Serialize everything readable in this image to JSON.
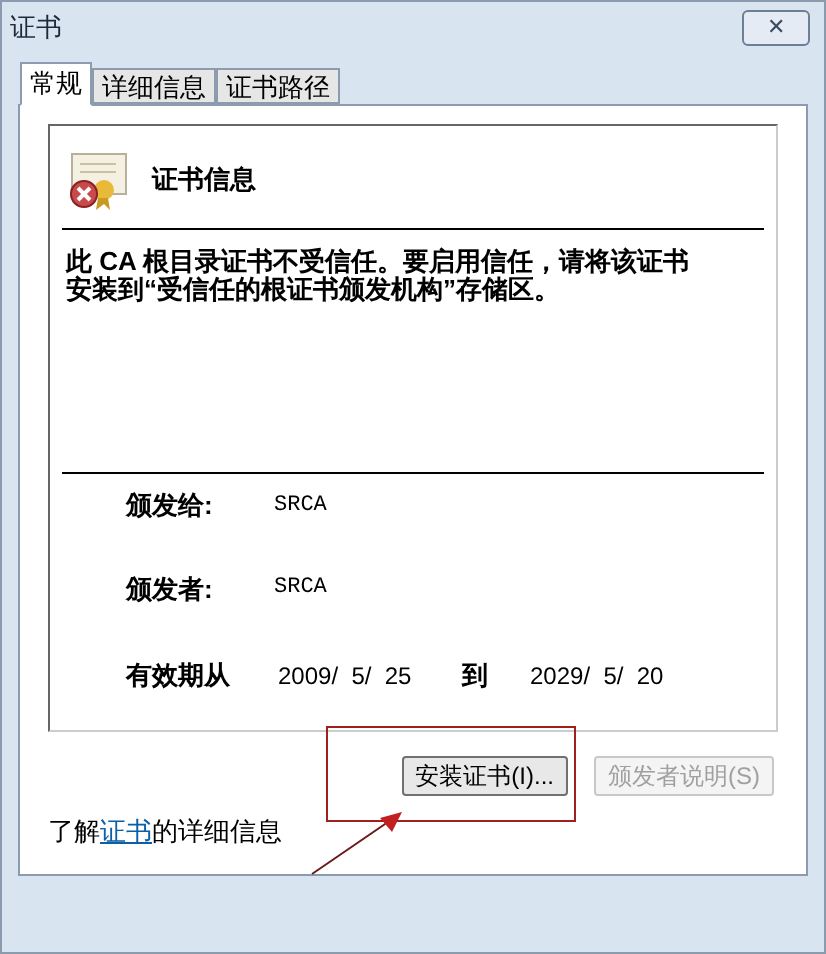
{
  "window": {
    "title": "证书",
    "close": "✕"
  },
  "tabs": [
    {
      "label": "常规",
      "selected": true
    },
    {
      "label": "详细信息",
      "selected": false
    },
    {
      "label": "证书路径",
      "selected": false
    }
  ],
  "certificate": {
    "heading": "证书信息",
    "message": "此 CA 根目录证书不受信任。要启用信任，请将该证书安装到“受信任的根证书颁发机构”存储区。",
    "issued_to": {
      "label": "颁发给:",
      "value": "SRCA"
    },
    "issued_by": {
      "label": "颁发者:",
      "value": "SRCA"
    },
    "validity": {
      "label": "有效期从",
      "from": "2009/  5/  25",
      "to_label": "到",
      "to": "2029/  5/  20"
    }
  },
  "buttons": [
    {
      "label": "安装证书(I)...",
      "disabled": false
    },
    {
      "label": "颁发者说明(S)",
      "disabled": true
    }
  ],
  "learn_more": {
    "before": "了解",
    "link": "证书",
    "after": "的详细信息"
  }
}
